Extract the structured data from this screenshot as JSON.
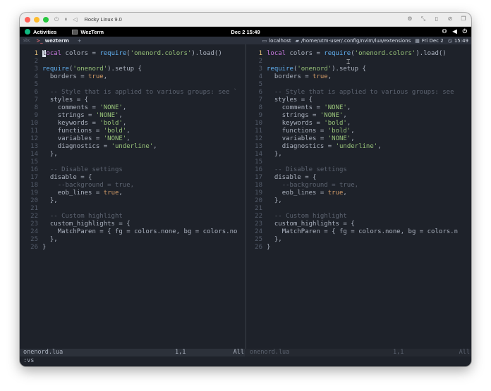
{
  "vm_window": {
    "title": "Rocky Linux 9.0",
    "controls_left": [
      "power-icon",
      "pause-icon",
      "back-icon"
    ],
    "controls_right": [
      "gear-icon",
      "resize-icon",
      "usb-icon",
      "share-icon",
      "window-icon"
    ]
  },
  "gnome_bar": {
    "activities": "Activities",
    "app_name": "WezTerm",
    "clock": "Dec 2  15:49"
  },
  "tabbar": {
    "tab_index": "sbc",
    "active_tab": "wezterm",
    "new_tab": "+",
    "host": "localhost",
    "path": "/home/utm-user/.config/nvim/lua/extensions",
    "date": "Fri Dec 2",
    "time": "15:49"
  },
  "editor": {
    "left_lines": [
      "local colors = require('onenord.colors').load()",
      "",
      "require('onenord').setup {",
      "  borders = true,",
      "",
      "  -- Style that is applied to various groups: see `",
      "  styles = {",
      "    comments = 'NONE',",
      "    strings = 'NONE',",
      "    keywords = 'bold',",
      "    functions = 'bold',",
      "    variables = 'NONE',",
      "    diagnostics = 'underline',",
      "  },",
      "",
      "  -- Disable settings",
      "  disable = {",
      "    --background = true,",
      "    eob_lines = true,",
      "  },",
      "",
      "  -- Custom highlight",
      "  custom_highlights = {",
      "    MatchParen = { fg = colors.none, bg = colors.no",
      "  },",
      "}"
    ],
    "right_lines": [
      "local colors = require('onenord.colors').load()",
      "",
      "require('onenord').setup {",
      "  borders = true,",
      "",
      "  -- Style that is applied to various groups: see",
      "  styles = {",
      "    comments = 'NONE',",
      "    strings = 'NONE',",
      "    keywords = 'bold',",
      "    functions = 'bold',",
      "    variables = 'NONE',",
      "    diagnostics = 'underline',",
      "  },",
      "",
      "  -- Disable settings",
      "  disable = {",
      "    --background = true,",
      "    eob_lines = true,",
      "  },",
      "",
      "  -- Custom highlight",
      "  custom_highlights = {",
      "    MatchParen = { fg = colors.none, bg = colors.n",
      "  },",
      "}"
    ],
    "left_status": {
      "file": "onenord.lua",
      "position": "1,1",
      "scroll": "All"
    },
    "right_status": {
      "file": "onenord.lua",
      "position": "1,1",
      "scroll": "All"
    },
    "command_line": ":vs"
  },
  "colors": {
    "background": "#1e222a",
    "keyword": "#c678dd",
    "function": "#61afef",
    "string": "#98c379",
    "boolean": "#d19a66",
    "comment": "#5c6370",
    "traffic_close": "#ff5f57",
    "traffic_min": "#febc2e",
    "traffic_max": "#28c840"
  }
}
